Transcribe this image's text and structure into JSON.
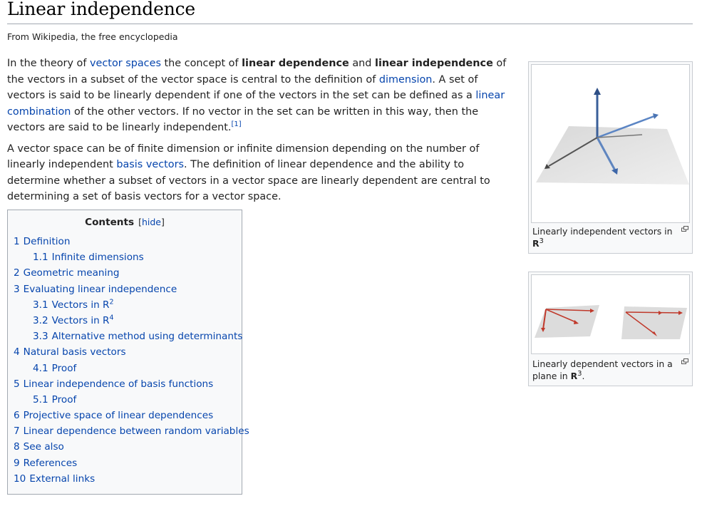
{
  "article": {
    "title": "Linear independence",
    "tagline": "From Wikipedia, the free encyclopedia"
  },
  "intro": {
    "p1": {
      "t1": "In the theory of ",
      "link_vector_spaces": "vector spaces",
      "t2": " the concept of ",
      "bold1": "linear dependence",
      "t3": " and ",
      "bold2": "linear independence",
      "t4": " of the vectors in a subset of the vector space is central to the definition of ",
      "link_dimension": "dimension",
      "t5": ". A set of vectors is said to be linearly dependent if one of the vectors in the set can be defined as a ",
      "link_linear_combination": "linear combination",
      "t6": " of the other vectors. If no vector in the set can be written in this way, then the vectors are said to be linearly independent.",
      "ref": "[1]"
    },
    "p2": {
      "t1": "A vector space can be of finite dimension or infinite dimension depending on the number of linearly independent ",
      "link_basis_vectors": "basis vectors",
      "t2": ". The definition of linear dependence and the ability to determine whether a subset of vectors in a vector space are linearly dependent are central to determining a set of basis vectors for a vector space."
    }
  },
  "toc": {
    "title": "Contents",
    "hide_open": "[",
    "hide_label": "hide",
    "hide_close": "]",
    "items": [
      {
        "num": "1",
        "label": "Definition"
      },
      {
        "num": "1.1",
        "label": "Infinite dimensions"
      },
      {
        "num": "2",
        "label": "Geometric meaning"
      },
      {
        "num": "3",
        "label": "Evaluating linear independence"
      },
      {
        "num": "3.1",
        "label": "Vectors in R",
        "sup": "2"
      },
      {
        "num": "3.2",
        "label": "Vectors in R",
        "sup": "4"
      },
      {
        "num": "3.3",
        "label": "Alternative method using determinants"
      },
      {
        "num": "4",
        "label": "Natural basis vectors"
      },
      {
        "num": "4.1",
        "label": "Proof"
      },
      {
        "num": "5",
        "label": "Linear independence of basis functions"
      },
      {
        "num": "5.1",
        "label": "Proof"
      },
      {
        "num": "6",
        "label": "Projective space of linear dependences"
      },
      {
        "num": "7",
        "label": "Linear dependence between random variables"
      },
      {
        "num": "8",
        "label": "See also"
      },
      {
        "num": "9",
        "label": "References"
      },
      {
        "num": "10",
        "label": "External links"
      }
    ]
  },
  "figures": {
    "fig1": {
      "caption_text": "Linearly independent vectors in ",
      "caption_bold": "R",
      "caption_sup": "3"
    },
    "fig2": {
      "caption_text": "Linearly dependent vectors in a plane in ",
      "caption_bold": "R",
      "caption_sup": "3",
      "caption_end": "."
    }
  },
  "colors": {
    "link": "#0645ad",
    "border": "#a2a9b1",
    "vector_blue": "#4a6fa5",
    "vector_red": "#c0392b"
  }
}
